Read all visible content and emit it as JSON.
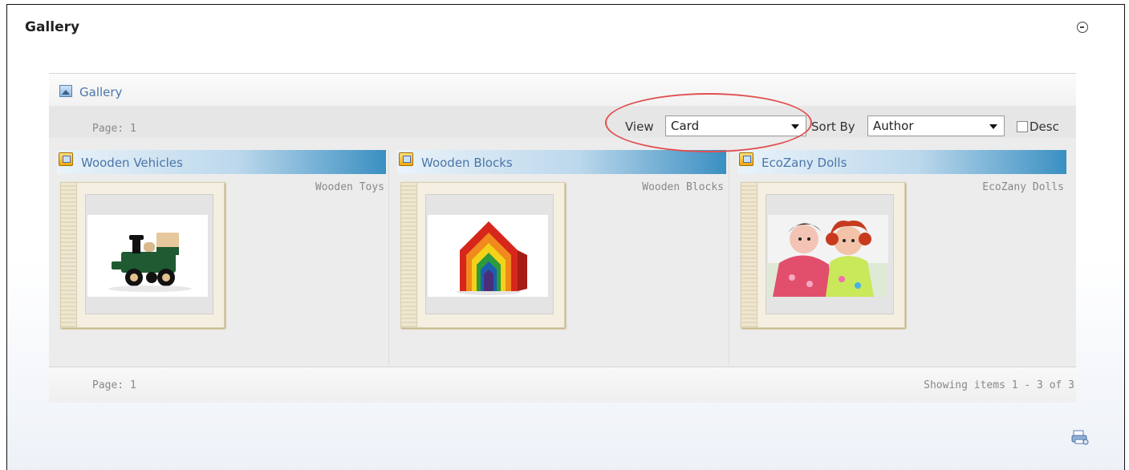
{
  "module": {
    "title": "Gallery"
  },
  "gallery": {
    "title": "Gallery",
    "page_top": "Page: 1",
    "page_bottom": "Page: 1",
    "showing": "Showing items 1 - 3 of 3",
    "view_label": "View",
    "view_value": "Card",
    "sort_label": "Sort By",
    "sort_value": "Author",
    "desc_label": "Desc",
    "desc_checked": false
  },
  "albums": [
    {
      "title": "Wooden Vehicles",
      "category": "Wooden Toys",
      "image": "wooden-train-toy"
    },
    {
      "title": "Wooden Blocks",
      "category": "Wooden Blocks",
      "image": "rainbow-house-blocks"
    },
    {
      "title": "EcoZany Dolls",
      "category": "EcoZany Dolls",
      "image": "rag-dolls"
    }
  ],
  "colors": {
    "link": "#4a76a8",
    "header_gradient_end": "#3a8fc2",
    "highlight_ellipse": "#e05050"
  }
}
